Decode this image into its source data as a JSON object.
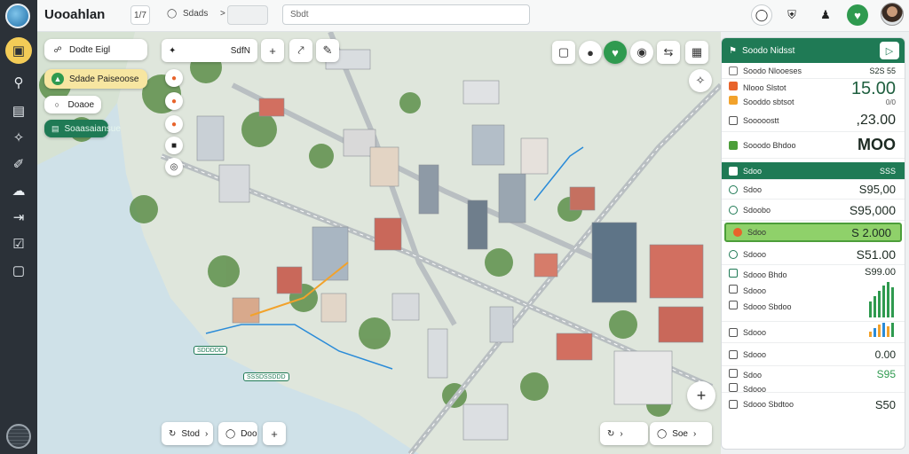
{
  "app": {
    "title": "Uooahlan"
  },
  "topbar": {
    "counter": "1/7",
    "menu_label": "Sdads",
    "nav_arrow": ">",
    "search_placeholder": "Sbdt"
  },
  "rail": {
    "items": [
      {
        "icon": "monitor-icon"
      },
      {
        "icon": "location-pin-icon"
      },
      {
        "icon": "book-icon"
      },
      {
        "icon": "network-icon"
      },
      {
        "icon": "brush-icon"
      },
      {
        "icon": "cloud-icon"
      },
      {
        "icon": "login-icon"
      },
      {
        "icon": "checklist-icon"
      },
      {
        "icon": "image-icon"
      }
    ]
  },
  "map_left": {
    "chip1": "Dodte Eigl",
    "chip2": "Sdade Paiseoose",
    "chip3": "Doaoe",
    "chip4": "Soaasaiansue"
  },
  "map_toolbar": {
    "label": "SdfN"
  },
  "map_footer": {
    "chip1": "Stod",
    "chip2": "Doo"
  },
  "map_footer_right": {
    "chip1": "Soe"
  },
  "map_tags": [
    "SDDDDD",
    "SSSDSSDDD"
  ],
  "panel": {
    "title": "Soodo Nidsst",
    "subtitle_label": "Soodo Nlooeses",
    "subtitle_value": "S2S 55",
    "rows": [
      {
        "label": "Nlooo Slstot",
        "value": ""
      },
      {
        "label": "Sooddo sbtsot",
        "value": ""
      },
      {
        "label": "Sooooostt",
        "value": ""
      },
      {
        "label": "Sooodo Bhdoo",
        "value": ""
      }
    ],
    "big_value": "15.00",
    "big_sub": "0/0",
    "value2": ",23.00",
    "value3": "MOO",
    "band1": {
      "label": "Sdoo",
      "value": "SSS"
    },
    "list": [
      {
        "label": "Sdoo",
        "value": "S95,00"
      },
      {
        "label": "Sdoobo",
        "value": "S95,000"
      },
      {
        "label": "Sdoo",
        "value": "S 2.000"
      },
      {
        "label": "Sdooo",
        "value": "S51.00"
      },
      {
        "label": "Sdooo Bhdo",
        "value": "S99.00"
      },
      {
        "label": "Sdooo",
        "value": ""
      },
      {
        "label": "Sdooo Sbdoo",
        "value": ""
      },
      {
        "label": "Sdooo",
        "value": ""
      },
      {
        "label": "Sdooo",
        "value": "0.00"
      },
      {
        "label": "Sdoo",
        "value": "S95"
      },
      {
        "label": "Sdooo",
        "value": ""
      },
      {
        "label": "Sdooo Sbdtoo",
        "value": "S50"
      }
    ]
  },
  "colors": {
    "brand": "#1f7a55",
    "accent": "#f3cc57",
    "highlight": "#8fd16a"
  }
}
